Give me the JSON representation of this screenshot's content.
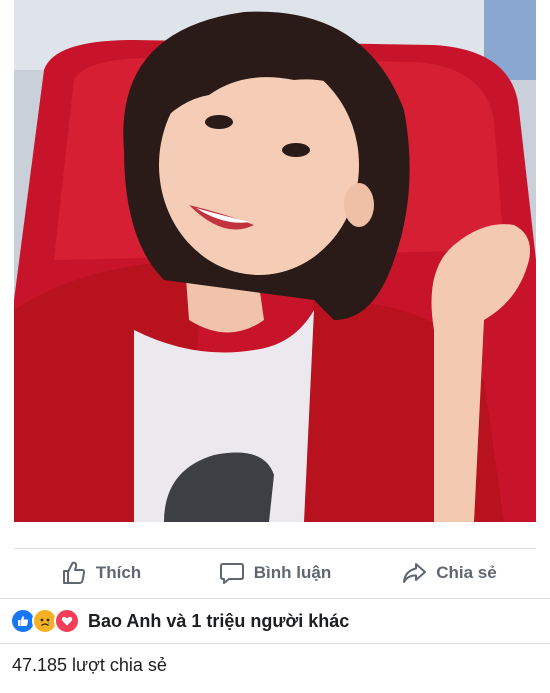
{
  "photo": {
    "icon": "portrait-photo"
  },
  "actions": {
    "like_label": "Thích",
    "comment_label": "Bình luận",
    "share_label": "Chia sẻ"
  },
  "reactions": {
    "summary": "Bao Anh và 1 triệu người khác",
    "icons": [
      "like-reaction-icon",
      "sad-reaction-icon",
      "love-reaction-icon"
    ],
    "colors": {
      "like": "#1877f2",
      "sad": "#f7b125",
      "love": "#f33e58"
    }
  },
  "shares": {
    "count_text": "47.185 lượt chia sẻ"
  }
}
